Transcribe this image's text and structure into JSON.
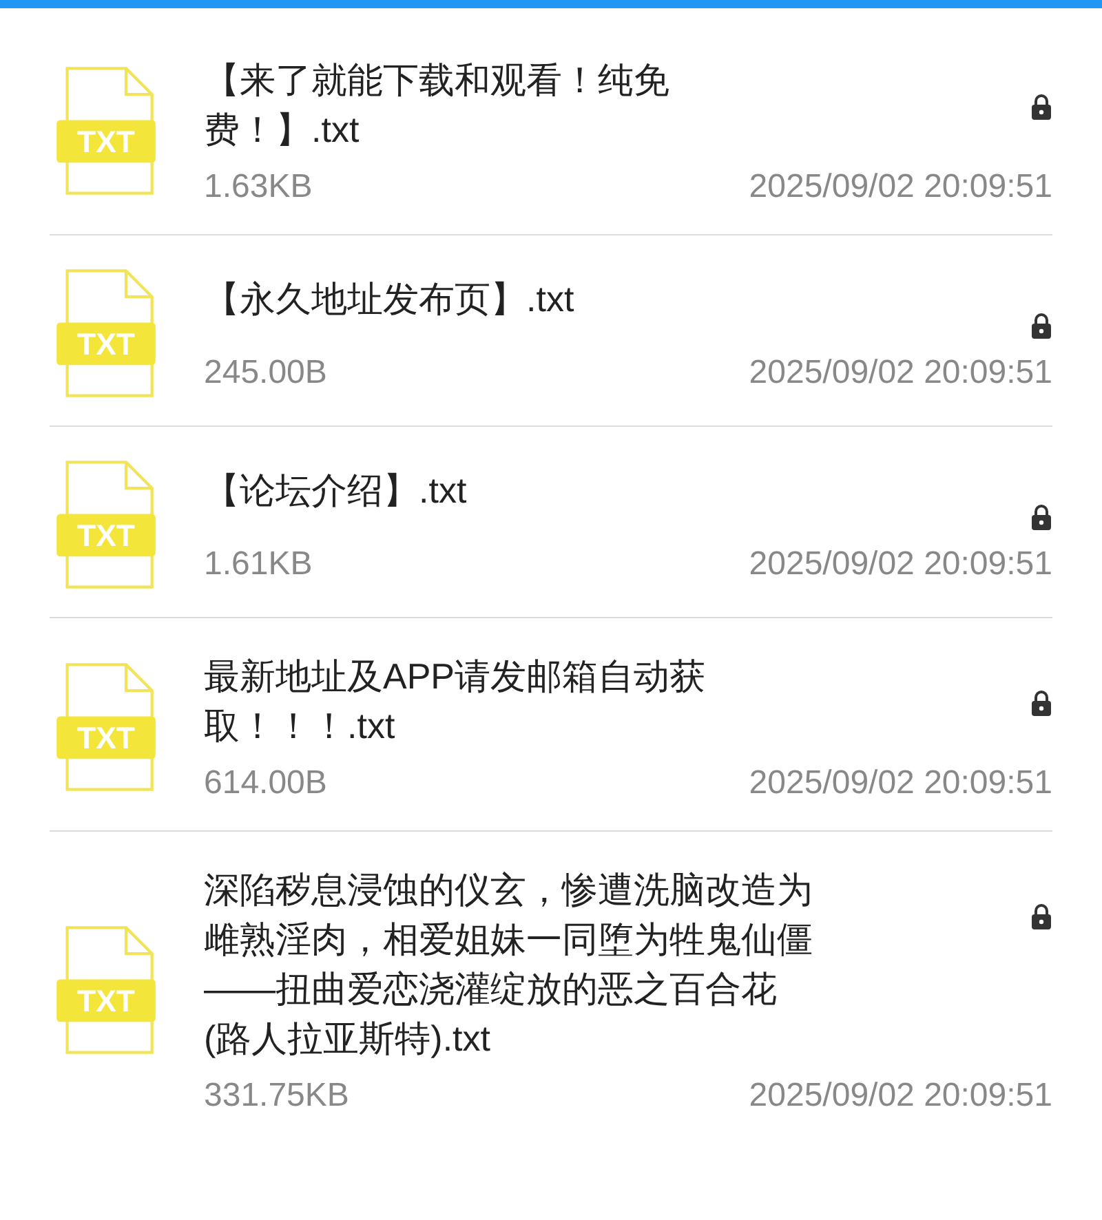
{
  "files": [
    {
      "icon_label": "TXT",
      "name_lines": [
        "【来了就能下载和观看！纯免",
        "费！】.txt"
      ],
      "size": "1.63KB",
      "modified": "2025/09/02 20:09:51",
      "locked": true
    },
    {
      "icon_label": "TXT",
      "name_lines": [
        "【永久地址发布页】.txt"
      ],
      "size": "245.00B",
      "modified": "2025/09/02 20:09:51",
      "locked": true
    },
    {
      "icon_label": "TXT",
      "name_lines": [
        "【论坛介绍】.txt"
      ],
      "size": "1.61KB",
      "modified": "2025/09/02 20:09:51",
      "locked": true
    },
    {
      "icon_label": "TXT",
      "name_lines": [
        "最新地址及APP请发邮箱自动获",
        "取！！！.txt"
      ],
      "size": "614.00B",
      "modified": "2025/09/02 20:09:51",
      "locked": true
    },
    {
      "icon_label": "TXT",
      "name_lines": [
        "深陷秽息浸蚀的仪玄，惨遭洗脑改造为",
        "雌熟淫肉，相爱姐妹一同堕为牲鬼仙僵",
        "——扭曲爱恋浇灌绽放的恶之百合花",
        "(路人拉亚斯特).txt"
      ],
      "size": "331.75KB",
      "modified": "2025/09/02 20:09:51",
      "locked": true
    }
  ]
}
